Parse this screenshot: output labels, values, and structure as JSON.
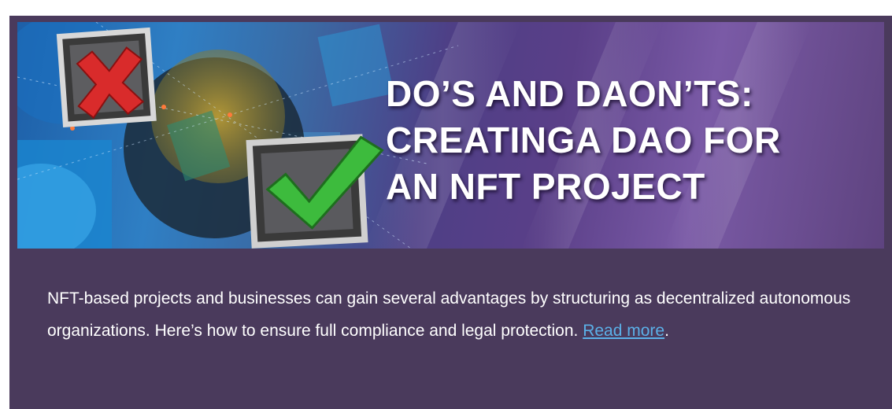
{
  "banner": {
    "headline_lines": [
      "DO’S AND DAON’TS:",
      "CREATINGA DAO FOR",
      "AN NFT PROJECT"
    ],
    "icons": [
      "x-mark-checkbox-icon",
      "check-mark-checkbox-icon"
    ]
  },
  "article": {
    "summary": "NFT-based projects and businesses can gain several advantages by structuring as decentralized autonomous organizations. Here’s how to ensure full compliance and legal protection.",
    "read_more_label": "Read more",
    "trailing_punct": "."
  },
  "colors": {
    "card_background": "#4a3a5c",
    "link": "#5bb0e8",
    "check_green": "#3dbb3d",
    "x_red": "#d92b2b"
  }
}
